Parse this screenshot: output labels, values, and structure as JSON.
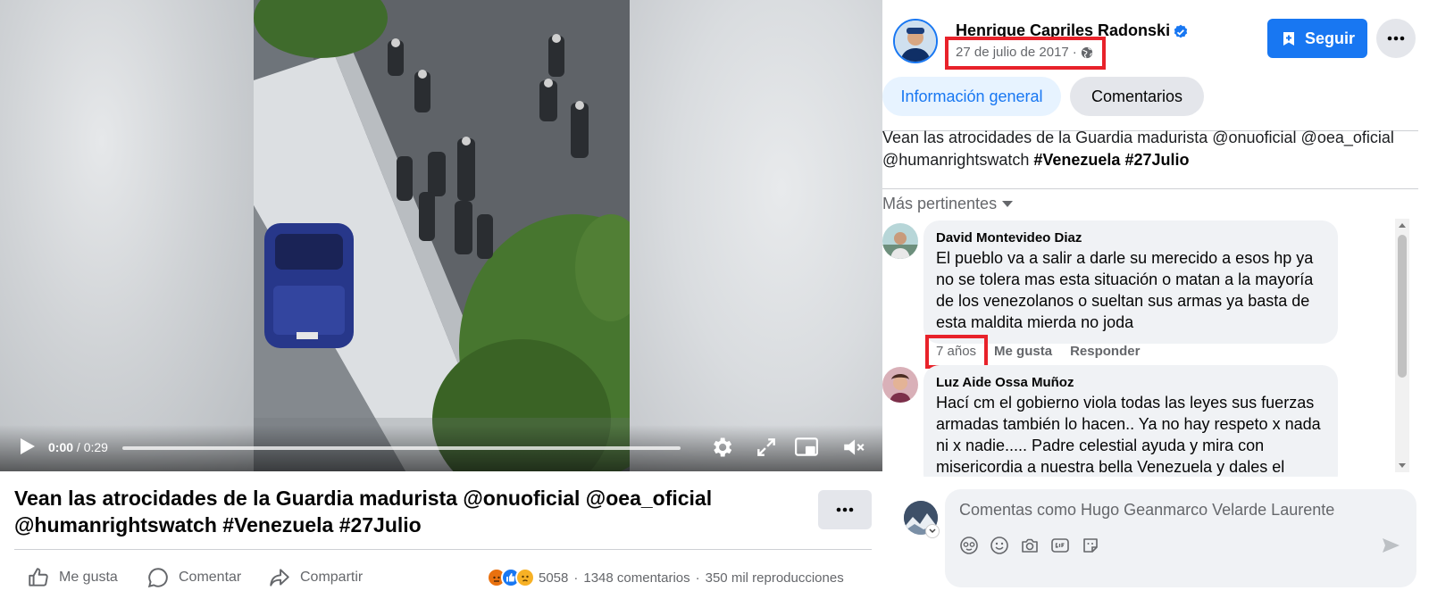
{
  "video": {
    "time_current": "0:00",
    "time_separator": " / ",
    "time_total": "0:29",
    "progress": 0
  },
  "post": {
    "title_line1": "Vean las atrocidades de la Guardia madurista @onuoficial @oea_oficial",
    "title_line2": "@humanrightswatch #Venezuela #27Julio",
    "actions": {
      "like": "Me gusta",
      "comment": "Comentar",
      "share": "Compartir"
    },
    "stats": {
      "reaction_count": "5058",
      "comments": "1348 comentarios",
      "views": "350 mil reproducciones",
      "separator": "·"
    }
  },
  "sidebar": {
    "author": "Henrique Capriles Radonski",
    "date": "27 de julio de 2017",
    "date_separator": "·",
    "follow_label": "Seguir",
    "tabs": [
      {
        "label": "Información general"
      },
      {
        "label": "Comentarios"
      }
    ],
    "caption": {
      "text": "Vean las atrocidades de la Guardia madurista @onuoficial @oea_oficial @humanrightswatch",
      "tag1": "#Venezuela",
      "tag2": "#27Julio"
    },
    "sort_label": "Más pertinentes",
    "comments": [
      {
        "author": "David Montevideo Diaz",
        "text": "El pueblo va a salir a darle su merecido a esos hp ya no se tolera mas esta situación o matan a la mayoría de los venezolanos o sueltan sus armas ya basta de esta maldita mierda no joda",
        "time": "7 años",
        "like": "Me gusta",
        "reply": "Responder"
      },
      {
        "author": "Luz Aide Ossa Muñoz",
        "text": "Hací cm el gobierno viola todas las leyes sus fuerzas armadas también lo hacen.. Ya no hay respeto x nada ni x nadie..... Padre celestial ayuda y mira con misericordia a nuestra bella Venezuela y dales el"
      }
    ],
    "composer_placeholder": "Comentas como Hugo Geanmarco Velarde Laurente"
  },
  "colors": {
    "brand_blue": "#1877f2",
    "highlight_red": "#e8222a",
    "bubble_gray": "#f0f2f5"
  }
}
